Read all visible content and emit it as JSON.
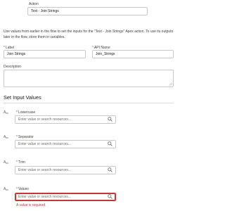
{
  "action": {
    "label": "Action",
    "value": "Text - Join Strings"
  },
  "intro_text": "Use values from earlier in the flow to set the inputs for the \"Text - Join Strings\" Apex action. To use its outputs later in the flow, store them in variables.",
  "label_field": {
    "label": "Label",
    "value": "Join Strings"
  },
  "api_name_field": {
    "label": "API Name",
    "value": "Join_Strings"
  },
  "description_field": {
    "label": "Description",
    "value": ""
  },
  "required_marker": "*",
  "section_title": "Set Input Values",
  "type_icon_text": "A",
  "type_icon_sub": "bc",
  "inputs": [
    {
      "label": "Lowercase",
      "placeholder": "Enter value or search resources..."
    },
    {
      "label": "Separator",
      "placeholder": "Enter value or search resources..."
    },
    {
      "label": "Trim",
      "placeholder": "Enter value or search resources..."
    },
    {
      "label": "Values",
      "placeholder": "Enter value or search resources...",
      "error": "A value is required."
    }
  ],
  "colors": {
    "error": "#c23934",
    "border": "#c9c9c9"
  },
  "icons": {
    "search": "search-icon",
    "type": "text-type-icon",
    "resize": "resize-handle-icon"
  }
}
